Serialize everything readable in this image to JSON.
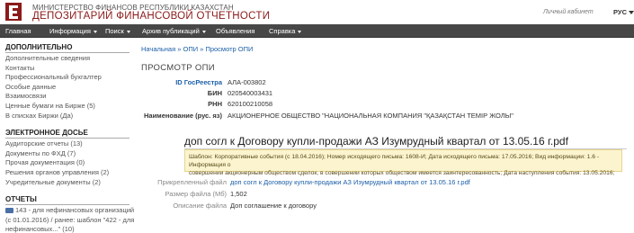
{
  "header": {
    "org_line1": "МИНИСТЕРСТВО ФИНАНСОВ РЕСПУБЛИКИ КАЗАХСТАН",
    "org_line2": "ДЕПОЗИТАРИЙ ФИНАНСОВОЙ ОТЧЕТНОСТИ",
    "cabinet_link": "Личный кабинет",
    "language": "РУС"
  },
  "nav": {
    "items": [
      "Главная",
      "Информация",
      "Поиск",
      "Архив публикаций",
      "Объявления",
      "Справка"
    ]
  },
  "sidebar": {
    "additional_title": "ДОПОЛНИТЕЛЬНО",
    "additional_items": [
      "Дополнительные сведения",
      "Контакты",
      "Профессиональный бухгалтер",
      "Особые данные",
      "Взаимосвязи",
      "Ценные бумаги на Бирже (5)",
      "В списках Биржи (Да)"
    ],
    "dossier_title": "ЭЛЕКТРОННОЕ ДОСЬЕ",
    "dossier_items": [
      "Аудиторские отчеты (13)",
      "Документы по ФХД (7)",
      "Прочая документация (0)",
      "Решения органов управления (2)",
      "Учредительные документы (2)"
    ],
    "reports_title": "ОТЧЕТЫ",
    "report_item_lines": [
      "143 - для нефинансовых организаций",
      "(с 01.01.2016) / ранее: шаблон \"422 - для",
      "нефинансовых...\" (10)"
    ]
  },
  "breadcrumb": "Начальная » ОПИ » Просмотр ОПИ",
  "page_heading": "ПРОСМОТР ОПИ",
  "info": {
    "id_label": "ID ГосРеестра",
    "id_value": "АЛА-003802",
    "bin_label": "БИН",
    "bin_value": "020540003431",
    "rnn_label": "РНН",
    "rnn_value": "620100210058",
    "name_label": "Наименование (рус. яз)",
    "name_value": "АКЦИОНЕРНОЕ ОБЩЕСТВО \"НАЦИОНАЛЬНАЯ КОМПАНИЯ \"ҚАЗАҚСТАН ТЕМІР ЖОЛЫ\""
  },
  "document": {
    "title": "доп согл к Договору купли-продажи АЗ Изумрудный квартал от 13.05.16 г.pdf",
    "template_line1": "Шаблон: Корпоративные события (с 18.04.2016); Номер исходящего письма: 1608-И; Дата исходящего письма: 17.05.2016; Вид информации: 1.6 - Информация о",
    "template_line2": "совершении акционерным обществом сделок, в совершении которых обществом имеется заинтересованность; Дата наступления события: 13.05.2016;",
    "attached_label": "Прикрепленный файл",
    "attached_value": "доп согл к Договору купли-продажи АЗ Изумрудный квартал от 13.05.16 г.pdf",
    "size_label": "Размер файла (Мб)",
    "size_value": "1,502",
    "desc_label": "Описание файла",
    "desc_value": "Доп соглашение к договору"
  }
}
